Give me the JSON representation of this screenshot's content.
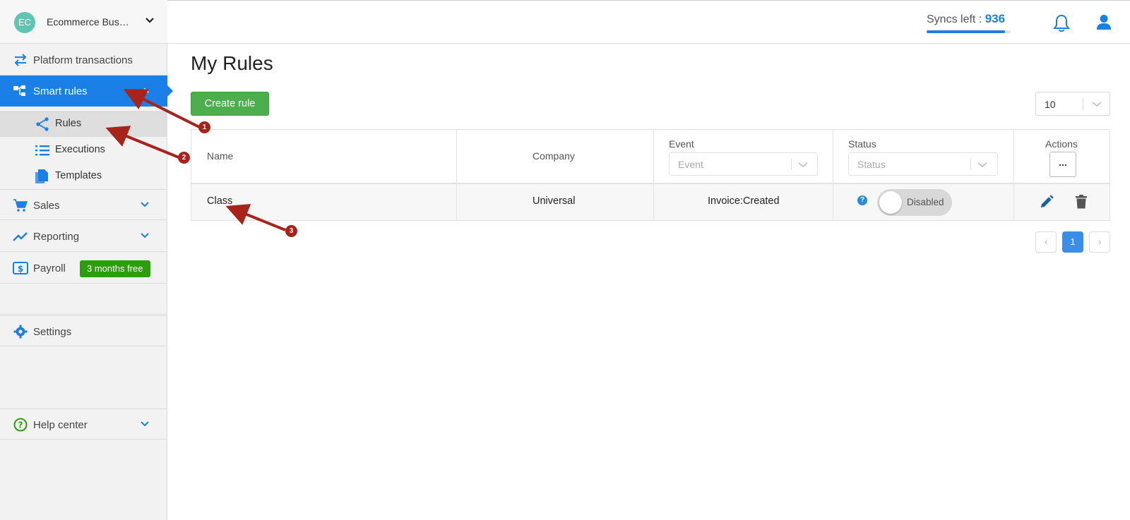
{
  "company": {
    "initials": "EC",
    "name": "Ecommerce Business"
  },
  "nav": {
    "platform_transactions": "Platform transactions",
    "smart_rules": "Smart rules",
    "rules": "Rules",
    "executions": "Executions",
    "templates": "Templates",
    "sales": "Sales",
    "reporting": "Reporting",
    "payroll": "Payroll",
    "payroll_badge": "3 months free",
    "settings": "Settings",
    "help_center": "Help center"
  },
  "header": {
    "syncs_label": "Syncs left :",
    "syncs_count": "936",
    "syncs_fraction": 0.93
  },
  "main": {
    "title": "My Rules",
    "create_button": "Create rule",
    "page_size": "10"
  },
  "table": {
    "columns": {
      "name": "Name",
      "company": "Company",
      "event": "Event",
      "status": "Status",
      "actions": "Actions"
    },
    "filters": {
      "event_placeholder": "Event",
      "status_placeholder": "Status"
    },
    "actions_menu": "...",
    "rows": [
      {
        "name": "Class",
        "company": "Universal",
        "event": "Invoice:Created",
        "status": "Disabled",
        "help": "?"
      }
    ]
  },
  "pagination": {
    "prev": "‹",
    "current": "1",
    "next": "›"
  },
  "annotations": [
    "1",
    "2",
    "3"
  ],
  "colors": {
    "accent": "#1a7fe6",
    "create": "#4cae4c",
    "badge": "#2e9c0f",
    "arrow": "#a8231a"
  }
}
